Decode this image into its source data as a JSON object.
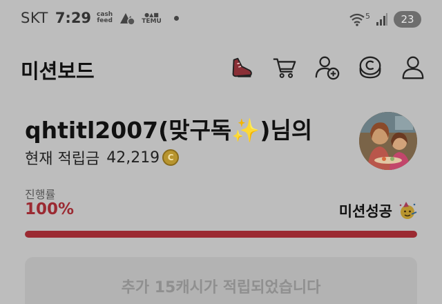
{
  "status_bar": {
    "carrier": "SKT",
    "time": "7:29",
    "app_chip_top": "cash",
    "app_chip_bottom": "feed",
    "temu_label": "TEMU",
    "network_label": "5",
    "battery": "23"
  },
  "header": {
    "title": "미션보드",
    "icons": [
      "sneaker-icon",
      "cart-icon",
      "add-user-icon",
      "coin-icon",
      "profile-icon"
    ]
  },
  "profile": {
    "name": "qhtitl2007(맞구독",
    "sparkle": "✨",
    "name_suffix": ")님의",
    "balance_label": "현재 적립금",
    "balance_value": "42,219",
    "coin_symbol": "C"
  },
  "progress": {
    "label": "진행률",
    "value_text": "100%",
    "fraction": 1.0,
    "status": "미션성공"
  },
  "notice": {
    "text": "추가 15캐시가 적립되었습니다"
  },
  "colors": {
    "accent": "#9b2a32",
    "overlay_bg": "#bdbdbd"
  }
}
